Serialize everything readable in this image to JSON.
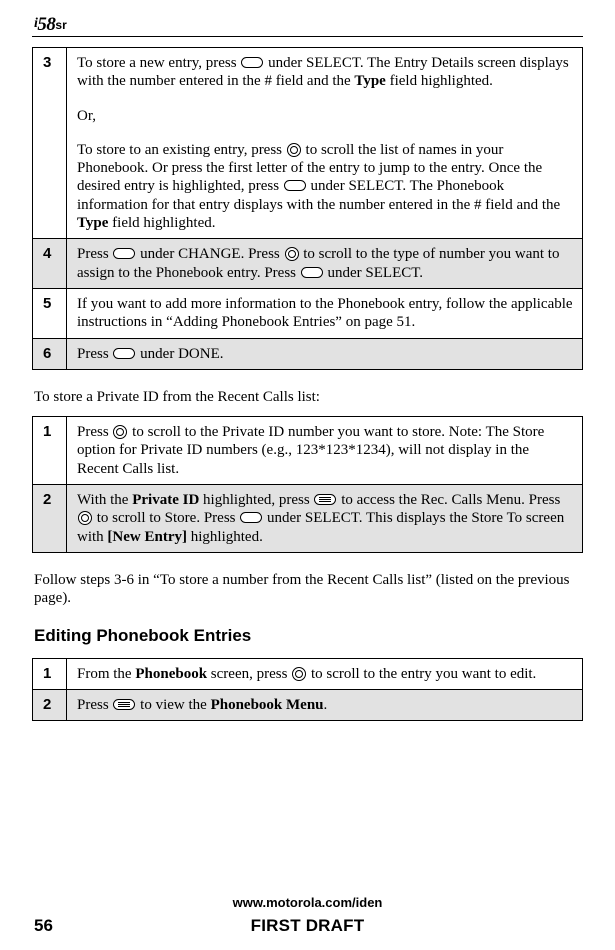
{
  "header": {
    "logo_text": "58",
    "logo_suffix": "sr"
  },
  "table1": {
    "rows": [
      {
        "num": "3",
        "shaded": false,
        "parts": [
          {
            "type": "text",
            "value": "To store a new entry, press "
          },
          {
            "type": "key",
            "variant": "oval"
          },
          {
            "type": "text",
            "value": " under SELECT. The Entry Details screen displays with the number entered in the # field and the "
          },
          {
            "type": "bold",
            "value": "Type"
          },
          {
            "type": "text",
            "value": " field highlighted."
          },
          {
            "type": "paragap"
          },
          {
            "type": "text",
            "value": "Or,"
          },
          {
            "type": "paragap"
          },
          {
            "type": "text",
            "value": "To store to an existing entry, press "
          },
          {
            "type": "key",
            "variant": "scroll"
          },
          {
            "type": "text",
            "value": " to scroll the list of names in your Phonebook. Or press the first letter of the entry to jump to the entry. Once the desired entry is highlighted, press "
          },
          {
            "type": "key",
            "variant": "oval"
          },
          {
            "type": "text",
            "value": " under SELECT. The Phonebook information for that entry displays with the number entered in the # field and the "
          },
          {
            "type": "bold",
            "value": "Type"
          },
          {
            "type": "text",
            "value": " field highlighted."
          }
        ]
      },
      {
        "num": "4",
        "shaded": true,
        "parts": [
          {
            "type": "text",
            "value": "Press "
          },
          {
            "type": "key",
            "variant": "oval"
          },
          {
            "type": "text",
            "value": " under CHANGE. Press "
          },
          {
            "type": "key",
            "variant": "scroll"
          },
          {
            "type": "text",
            "value": " to scroll to the type of number you want to assign to the Phonebook entry. Press "
          },
          {
            "type": "key",
            "variant": "oval"
          },
          {
            "type": "text",
            "value": " under SELECT."
          }
        ]
      },
      {
        "num": "5",
        "shaded": false,
        "parts": [
          {
            "type": "text",
            "value": "If you want to add more information to the Phonebook entry, follow the applicable instructions in “Adding Phonebook Entries” on page 51."
          }
        ]
      },
      {
        "num": "6",
        "shaded": true,
        "parts": [
          {
            "type": "text",
            "value": "Press "
          },
          {
            "type": "key",
            "variant": "oval"
          },
          {
            "type": "text",
            "value": " under DONE."
          }
        ]
      }
    ]
  },
  "mid_text": "To store a Private ID from the Recent Calls list:",
  "table2": {
    "rows": [
      {
        "num": "1",
        "shaded": false,
        "parts": [
          {
            "type": "text",
            "value": "Press "
          },
          {
            "type": "key",
            "variant": "scroll"
          },
          {
            "type": "text",
            "value": " to scroll to the Private ID number you want to store. Note: The Store option for Private ID numbers (e.g., 123*123*1234), will not display in the Recent Calls list."
          }
        ]
      },
      {
        "num": "2",
        "shaded": true,
        "parts": [
          {
            "type": "text",
            "value": "With the "
          },
          {
            "type": "bold",
            "value": "Private ID"
          },
          {
            "type": "text",
            "value": " highlighted, press "
          },
          {
            "type": "key",
            "variant": "menu"
          },
          {
            "type": "text",
            "value": " to access the Rec. Calls Menu. Press "
          },
          {
            "type": "key",
            "variant": "scroll"
          },
          {
            "type": "text",
            "value": " to scroll to Store. Press "
          },
          {
            "type": "key",
            "variant": "oval"
          },
          {
            "type": "text",
            "value": " under SELECT. This displays the Store To screen with "
          },
          {
            "type": "bold",
            "value": "[New Entry]"
          },
          {
            "type": "text",
            "value": " highlighted."
          }
        ]
      }
    ]
  },
  "after_text": "Follow steps 3-6 in “To store a number from the Recent Calls list” (listed on the previous page).",
  "heading": "Editing Phonebook Entries",
  "table3": {
    "rows": [
      {
        "num": "1",
        "shaded": false,
        "parts": [
          {
            "type": "text",
            "value": "From the "
          },
          {
            "type": "bold",
            "value": "Phonebook"
          },
          {
            "type": "text",
            "value": " screen, press "
          },
          {
            "type": "key",
            "variant": "scroll"
          },
          {
            "type": "text",
            "value": " to scroll to the entry you want to edit."
          }
        ]
      },
      {
        "num": "2",
        "shaded": true,
        "parts": [
          {
            "type": "text",
            "value": "Press "
          },
          {
            "type": "key",
            "variant": "menu"
          },
          {
            "type": "text",
            "value": " to view the "
          },
          {
            "type": "bold",
            "value": "Phonebook Menu"
          },
          {
            "type": "text",
            "value": "."
          }
        ]
      }
    ]
  },
  "footer": {
    "url": "www.motorola.com/iden",
    "page_num": "56",
    "draft": "FIRST DRAFT"
  }
}
